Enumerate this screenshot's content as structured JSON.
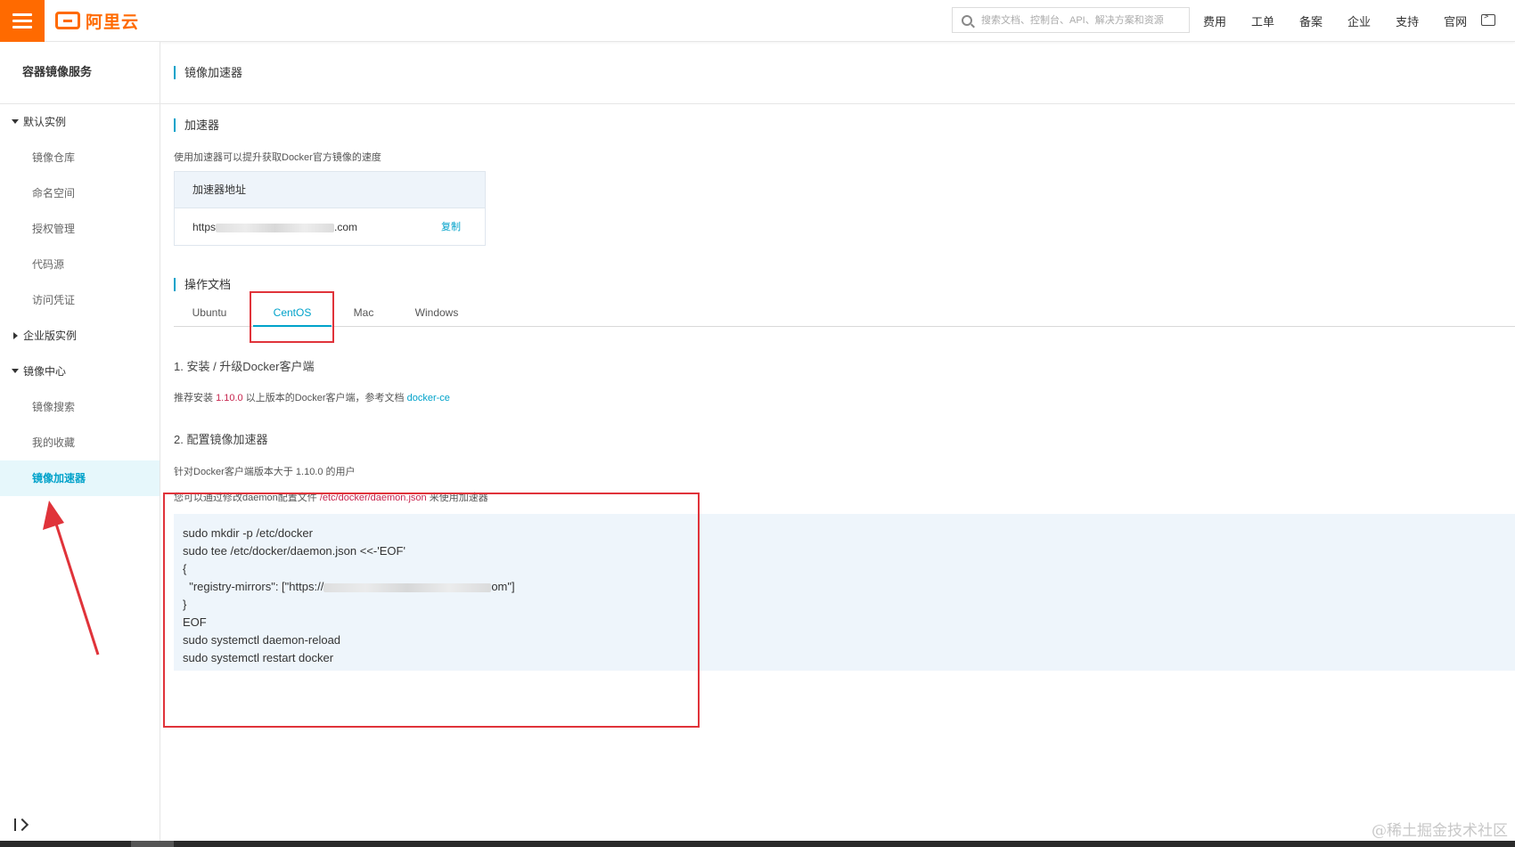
{
  "topbar": {
    "logo_text": "阿里云",
    "search_placeholder": "搜索文档、控制台、API、解决方案和资源",
    "nav": [
      "费用",
      "工单",
      "备案",
      "企业",
      "支持",
      "官网"
    ],
    "brand_color": "#ff6a00"
  },
  "sidebar": {
    "title": "容器镜像服务",
    "groups": [
      {
        "label": "默认实例",
        "expanded": true,
        "items": [
          "镜像仓库",
          "命名空间",
          "授权管理",
          "代码源",
          "访问凭证"
        ]
      },
      {
        "label": "企业版实例",
        "expanded": false,
        "items": []
      },
      {
        "label": "镜像中心",
        "expanded": true,
        "items": [
          "镜像搜索",
          "我的收藏",
          "镜像加速器"
        ]
      }
    ],
    "active_item": "镜像加速器"
  },
  "main": {
    "page_title": "镜像加速器",
    "accelerator": {
      "title": "加速器",
      "description": "使用加速器可以提升获取Docker官方镜像的速度",
      "address_header": "加速器地址",
      "address_prefix": "https",
      "address_suffix": ".com",
      "copy_label": "复制"
    },
    "docs": {
      "title": "操作文档",
      "tabs": [
        "Ubuntu",
        "CentOS",
        "Mac",
        "Windows"
      ],
      "active_tab": "CentOS",
      "step1_title": "1. 安装 / 升级Docker客户端",
      "step1_text_a": "推荐安装 ",
      "step1_version": "1.10.0",
      "step1_text_b": " 以上版本的Docker客户端，参考文档 ",
      "step1_link": "docker-ce",
      "step2_title": "2. 配置镜像加速器",
      "step2_note": "针对Docker客户端版本大于 1.10.0 的用户",
      "step2_config_a": "您可以通过修改daemon配置文件 ",
      "step2_config_path": "/etc/docker/daemon.json",
      "step2_config_b": " 来使用加速器",
      "code": {
        "line1": "sudo mkdir -p /etc/docker",
        "line2": "sudo tee /etc/docker/daemon.json <<-'EOF'",
        "line3": "{",
        "line4_prefix": "  \"registry-mirrors\": [\"https://",
        "line4_suffix": "om\"]",
        "line5": "}",
        "line6": "EOF",
        "line7": "sudo systemctl daemon-reload",
        "line8": "sudo systemctl restart docker"
      }
    }
  },
  "watermark": "@稀土掘金技术社区",
  "accent_color": "#00a2ca",
  "annotation_color": "#e0333a"
}
